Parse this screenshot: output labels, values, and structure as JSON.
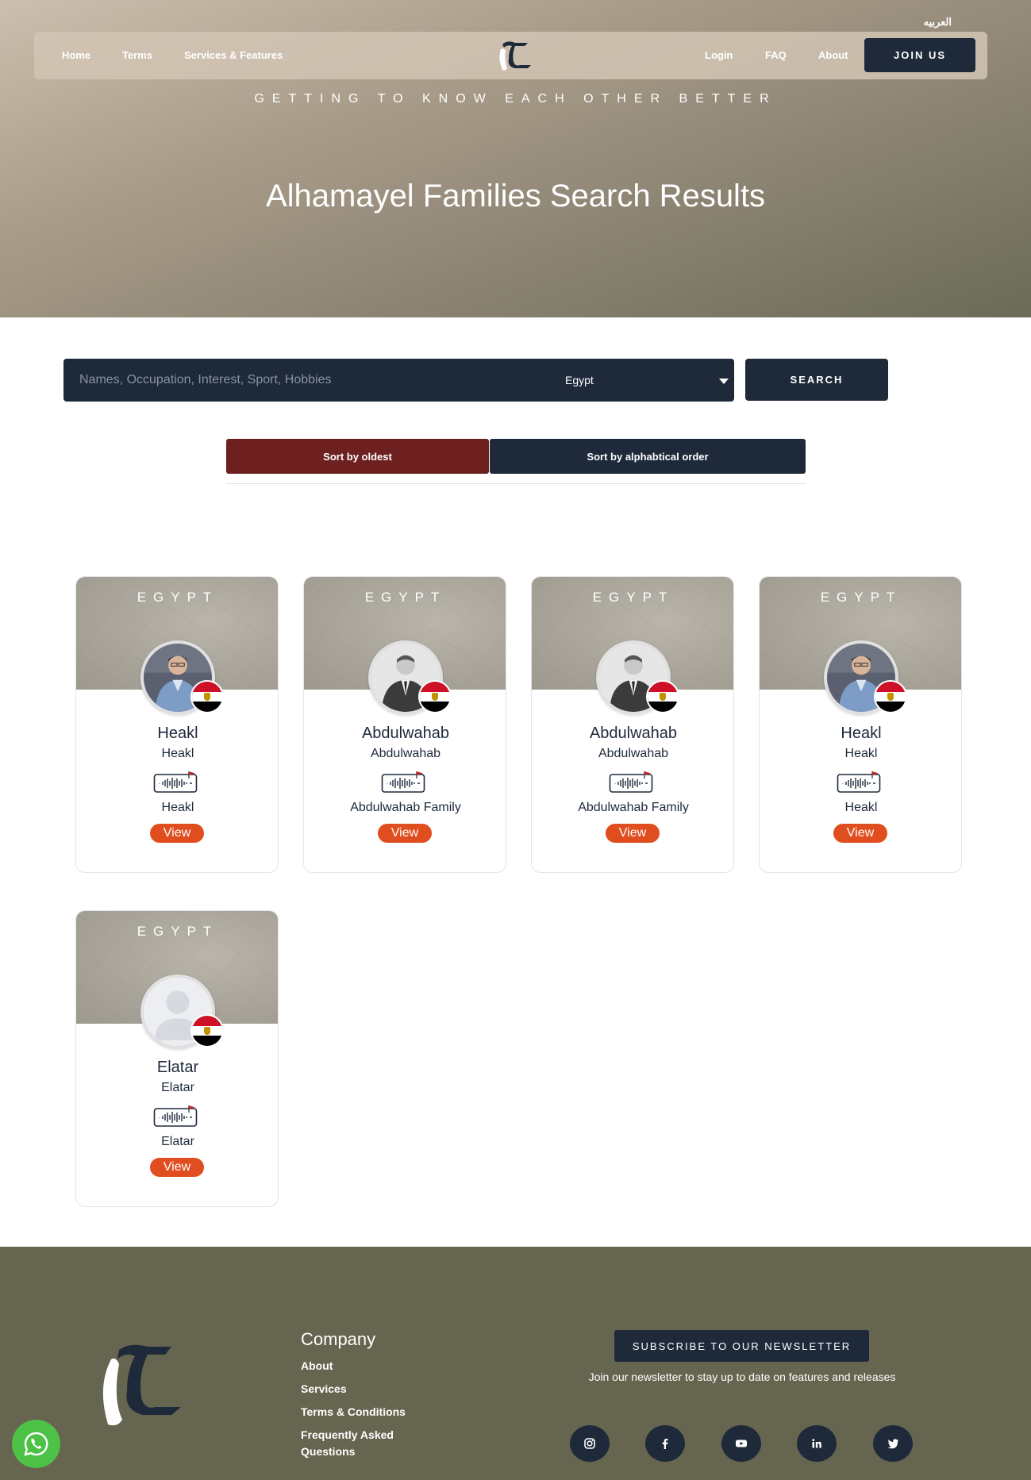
{
  "header": {
    "language_switch": "العربيه",
    "nav_left": [
      "Home",
      "Terms",
      "Services & Features"
    ],
    "nav_right": [
      "Login",
      "FAQ",
      "About"
    ],
    "join_label": "JOIN US",
    "tagline": "GETTING TO KNOW EACH OTHER BETTER",
    "title": "Alhamayel Families Search Results"
  },
  "search": {
    "placeholder": "Names, Occupation, Interest, Sport, Hobbies",
    "value": "",
    "country_selected": "Egypt",
    "button_label": "SEARCH"
  },
  "sort": {
    "oldest_label": "Sort by oldest",
    "alpha_label": "Sort by alphabtical order"
  },
  "results": [
    {
      "country": "EGYPT",
      "name": "Heakl",
      "subtitle": "Heakl",
      "family": "Heakl",
      "view_label": "View",
      "avatar": "man-blue-shirt"
    },
    {
      "country": "EGYPT",
      "name": "Abdulwahab",
      "subtitle": "Abdulwahab",
      "family": "Abdulwahab Family",
      "view_label": "View",
      "avatar": "man-suit-bw"
    },
    {
      "country": "EGYPT",
      "name": "Abdulwahab",
      "subtitle": "Abdulwahab",
      "family": "Abdulwahab Family",
      "view_label": "View",
      "avatar": "man-suit-bw"
    },
    {
      "country": "EGYPT",
      "name": "Heakl",
      "subtitle": "Heakl",
      "family": "Heakl",
      "view_label": "View",
      "avatar": "man-blue-shirt"
    },
    {
      "country": "EGYPT",
      "name": "Elatar",
      "subtitle": "Elatar",
      "family": "Elatar",
      "view_label": "View",
      "avatar": "default-silhouette"
    }
  ],
  "footer": {
    "company_title": "Company",
    "links": [
      "About",
      "Services",
      "Terms & Conditions",
      "Frequently Asked Questions"
    ],
    "newsletter_button": "SUBSCRIBE TO OUR NEWSLETTER",
    "newsletter_text": "Join our newsletter to stay up to date on features and releases",
    "social_icons": [
      "instagram-icon",
      "facebook-icon",
      "youtube-icon",
      "linkedin-icon",
      "twitter-icon"
    ]
  },
  "colors": {
    "navy": "#1e2a3a",
    "sort_active": "#6e2020",
    "view_button": "#e04e1f",
    "footer_bg": "#66654f",
    "whatsapp": "#4dc247"
  }
}
